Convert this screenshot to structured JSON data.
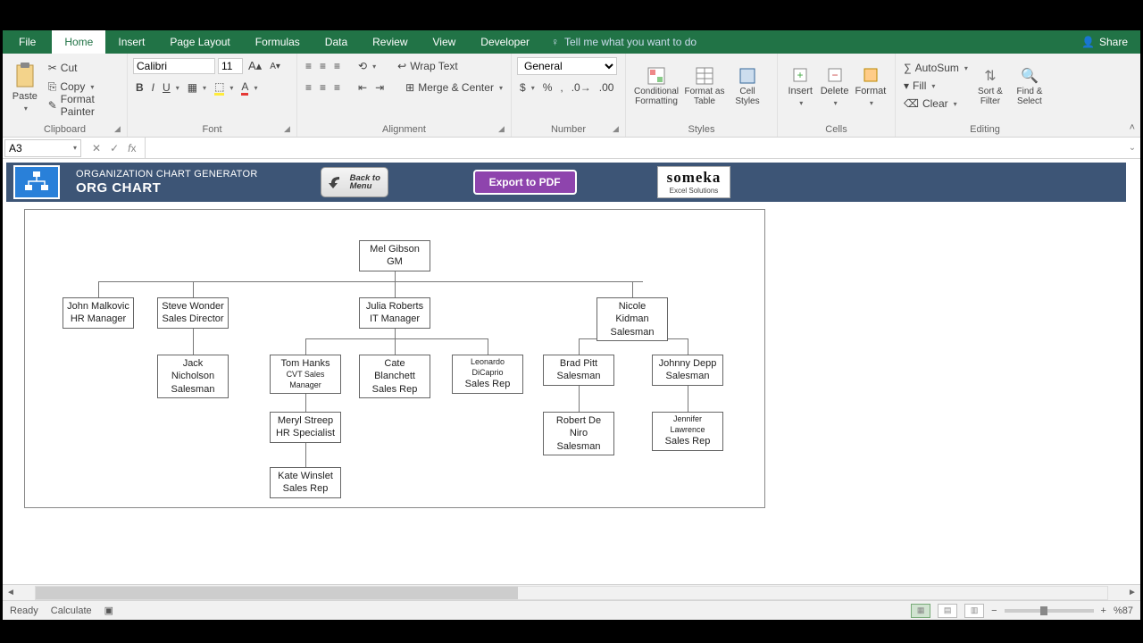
{
  "tabs": {
    "file": "File",
    "home": "Home",
    "insert": "Insert",
    "pageLayout": "Page Layout",
    "formulas": "Formulas",
    "data": "Data",
    "review": "Review",
    "view": "View",
    "developer": "Developer",
    "tell": "Tell me what you want to do",
    "share": "Share"
  },
  "ribbon": {
    "clipboard": {
      "paste": "Paste",
      "cut": "Cut",
      "copy": "Copy",
      "formatPainter": "Format Painter",
      "label": "Clipboard"
    },
    "font": {
      "name": "Calibri",
      "size": "11",
      "label": "Font"
    },
    "alignment": {
      "wrap": "Wrap Text",
      "merge": "Merge & Center",
      "label": "Alignment"
    },
    "number": {
      "format": "General",
      "label": "Number"
    },
    "styles": {
      "cond": "Conditional Formatting",
      "table": "Format as Table",
      "cell": "Cell Styles",
      "label": "Styles"
    },
    "cells": {
      "insert": "Insert",
      "delete": "Delete",
      "format": "Format",
      "label": "Cells"
    },
    "editing": {
      "autosum": "AutoSum",
      "fill": "Fill",
      "clear": "Clear",
      "sort": "Sort & Filter",
      "find": "Find & Select",
      "label": "Editing"
    }
  },
  "nameBox": "A3",
  "header": {
    "sub": "ORGANIZATION CHART GENERATOR",
    "main": "ORG CHART",
    "back1": "Back to",
    "back2": "Menu",
    "pdf": "Export to PDF",
    "brand": "someka",
    "brandSub": "Excel Solutions"
  },
  "chart_data": {
    "type": "org-chart",
    "nodes": [
      {
        "id": "n1",
        "name": "Mel Gibson",
        "role": "GM",
        "parent": null
      },
      {
        "id": "n2",
        "name": "John Malkovic",
        "role": "HR Manager",
        "parent": "n1"
      },
      {
        "id": "n3",
        "name": "Steve Wonder",
        "role": "Sales Director",
        "parent": "n1"
      },
      {
        "id": "n4",
        "name": "Julia Roberts",
        "role": "IT Manager",
        "parent": "n1"
      },
      {
        "id": "n5",
        "name": "Nicole Kidman",
        "role": "Salesman",
        "parent": "n1"
      },
      {
        "id": "n6",
        "name": "Jack Nicholson",
        "role": "Salesman",
        "parent": "n3"
      },
      {
        "id": "n7",
        "name": "Tom Hanks",
        "role": "CVT Sales Manager",
        "parent": "n4"
      },
      {
        "id": "n8",
        "name": "Cate Blanchett",
        "role": "Sales Rep",
        "parent": "n4"
      },
      {
        "id": "n9",
        "name": "Leonardo DiCaprio",
        "role": "Sales Rep",
        "parent": "n4"
      },
      {
        "id": "n10",
        "name": "Brad Pitt",
        "role": "Salesman",
        "parent": "n5"
      },
      {
        "id": "n11",
        "name": "Johnny Depp",
        "role": "Salesman",
        "parent": "n5"
      },
      {
        "id": "n12",
        "name": "Meryl Streep",
        "role": "HR Specialist",
        "parent": "n7"
      },
      {
        "id": "n13",
        "name": "Robert De Niro",
        "role": "Salesman",
        "parent": "n10"
      },
      {
        "id": "n14",
        "name": "Jennifer Lawrence",
        "role": "Sales Rep",
        "parent": "n11"
      },
      {
        "id": "n15",
        "name": "Kate Winslet",
        "role": "Sales Rep",
        "parent": "n12"
      }
    ]
  },
  "status": {
    "ready": "Ready",
    "calc": "Calculate",
    "zoom": "%87"
  }
}
